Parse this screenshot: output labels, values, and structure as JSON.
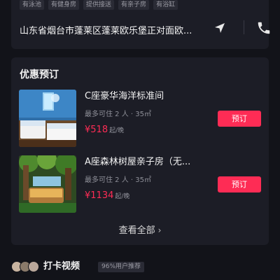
{
  "hotel": {
    "facilities": [
      "有泳池",
      "有健身房",
      "提供接送",
      "有亲子房",
      "有浴缸"
    ],
    "address": "山东省烟台市蓬莱区蓬莱欧乐堡正对面欧..."
  },
  "deals": {
    "title": "优惠预订",
    "rooms": [
      {
        "name": "C座豪华海洋标准间",
        "spec": "最多可住 2 人 · 35㎡",
        "price": "¥518",
        "price_unit": "起/晚",
        "book_label": "预订"
      },
      {
        "name": "A座森林树屋亲子房（无...",
        "spec": "最多可住 2 人 · 35㎡",
        "price": "¥1134",
        "price_unit": "起/晚",
        "book_label": "预订"
      }
    ],
    "view_all_label": "查看全部",
    "view_all_chevron": "›"
  },
  "videos": {
    "title": "打卡视频",
    "recommend_badge": "96%用户推荐"
  },
  "icons": {
    "navigation": "navigation-arrow-icon",
    "phone": "phone-icon",
    "chevron": "chevron-right-icon"
  },
  "colors": {
    "accent": "#fe2c55",
    "background": "#121319",
    "card": "#1c1d26"
  }
}
